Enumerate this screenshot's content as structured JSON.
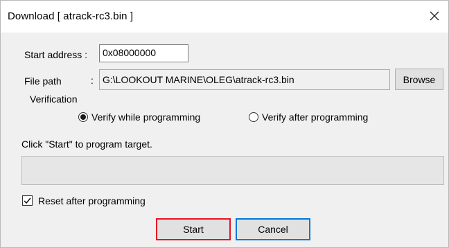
{
  "window": {
    "title": "Download [ atrack-rc3.bin ]",
    "close_icon": "close-icon"
  },
  "start_address": {
    "label": "Start address :",
    "value": "0x08000000"
  },
  "file_path": {
    "label": "File path",
    "separator": ":",
    "value": "G:\\LOOKOUT MARINE\\OLEG\\atrack-rc3.bin",
    "browse_label": "Browse"
  },
  "verification": {
    "group_label": "Verification",
    "options": [
      {
        "label": "Verify while programming",
        "selected": true
      },
      {
        "label": "Verify after programming",
        "selected": false
      }
    ]
  },
  "status": {
    "message": "Click \"Start\" to program target.",
    "progress_percent": 0
  },
  "reset_after_programming": {
    "label": "Reset after programming",
    "checked": true
  },
  "actions": {
    "start_label": "Start",
    "cancel_label": "Cancel",
    "start_highlight_color": "#e81123",
    "cancel_focus_color": "#0078d7"
  }
}
